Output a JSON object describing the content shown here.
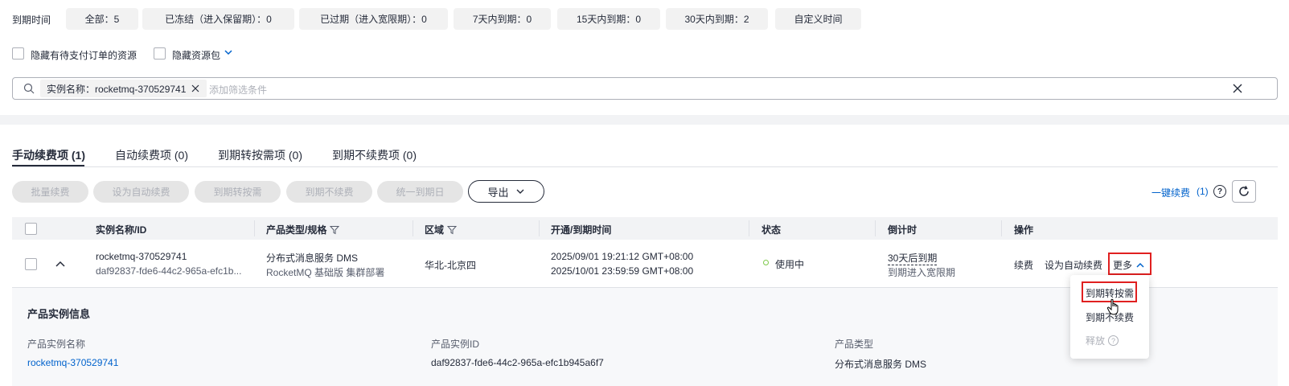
{
  "expiry_filter": {
    "label": "到期时间",
    "chips": [
      {
        "label": "全部：5"
      },
      {
        "label": "已冻结（进入保留期）：0"
      },
      {
        "label": "已过期（进入宽限期）：0"
      },
      {
        "label": "7天内到期：0"
      },
      {
        "label": "15天内到期：0"
      },
      {
        "label": "30天内到期：2"
      },
      {
        "label": "自定义时间"
      }
    ]
  },
  "options": {
    "hide_pending_orders": "隐藏有待支付订单的资源",
    "hide_packages": "隐藏资源包"
  },
  "search": {
    "tag": "实例名称：rocketmq-370529741",
    "placeholder": "添加筛选条件"
  },
  "tabs": [
    {
      "label": "手动续费项 (1)",
      "active": true
    },
    {
      "label": "自动续费项 (0)"
    },
    {
      "label": "到期转按需项 (0)"
    },
    {
      "label": "到期不续费项 (0)"
    }
  ],
  "actions": {
    "batch_renew": "批量续费",
    "set_auto": "设为自动续费",
    "to_on_demand": "到期转按需",
    "no_renew": "到期不续费",
    "unify_date": "统一到期日",
    "export": "导出",
    "one_click_renew": "一键续费",
    "one_click_count": "(1)"
  },
  "table": {
    "headers": {
      "name": "实例名称/ID",
      "product": "产品类型/规格",
      "region": "区域",
      "time": "开通/到期时间",
      "status": "状态",
      "countdown": "倒计时",
      "ops": "操作"
    },
    "row": {
      "name": "rocketmq-370529741",
      "id": "daf92837-fde6-44c2-965a-efc1b...",
      "product": "分布式消息服务 DMS",
      "spec": "RocketMQ 基础版 集群部署",
      "region": "华北-北京四",
      "open_time": "2025/09/01 19:21:12 GMT+08:00",
      "expire_time": "2025/10/01 23:59:59 GMT+08:00",
      "status": "使用中",
      "countdown": "30天后到期",
      "countdown_sub": "到期进入宽限期",
      "op_renew": "续费",
      "op_auto": "设为自动续费",
      "op_more": "更多"
    }
  },
  "detail": {
    "title": "产品实例信息",
    "fields": [
      {
        "label": "产品实例名称",
        "value": "rocketmq-370529741"
      },
      {
        "label": "产品实例ID",
        "value": "daf92837-fde6-44c2-965a-efc1b945a6f7"
      },
      {
        "label": "产品类型",
        "value": "分布式消息服务 DMS"
      }
    ]
  },
  "more_menu": {
    "items": [
      {
        "label": "到期转按需"
      },
      {
        "label": "到期不续费"
      },
      {
        "label": "释放"
      }
    ]
  },
  "colors": {
    "link": "#0062cc",
    "highlight": "#e02020",
    "status_dot": "#7ec94b"
  }
}
